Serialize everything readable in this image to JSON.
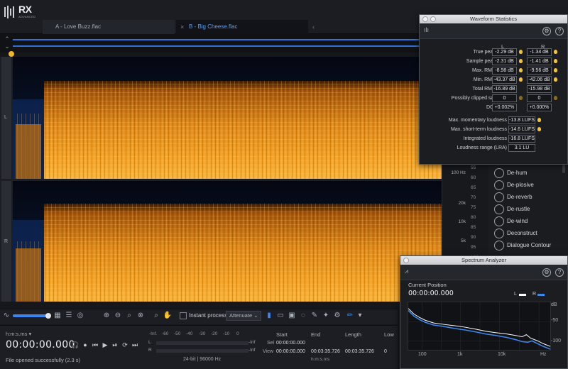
{
  "app": {
    "logo_text": "RX",
    "logo_sub": "ADVANCED"
  },
  "tabs": [
    {
      "label": "A - Love Buzz.flac",
      "active": false
    },
    {
      "label": "B - Big Cheese.flac",
      "active": true
    }
  ],
  "channels": [
    "L",
    "R"
  ],
  "freq_ticks": [
    {
      "label": "100",
      "unit": "Hz"
    },
    {
      "label": "20k",
      "unit": ""
    },
    {
      "label": "10k",
      "unit": ""
    },
    {
      "label": "5k",
      "unit": ""
    },
    {
      "label": "100",
      "unit": ""
    }
  ],
  "db_ticks": [
    "55",
    "60",
    "65",
    "70",
    "75",
    "80",
    "85",
    "90",
    "95",
    "100"
  ],
  "modules": [
    {
      "label": "De-hum",
      "icon": "de-hum-icon"
    },
    {
      "label": "De-plosive",
      "icon": "de-plosive-icon"
    },
    {
      "label": "De-reverb",
      "icon": "de-reverb-icon"
    },
    {
      "label": "De-rustle",
      "icon": "de-rustle-icon"
    },
    {
      "label": "De-wind",
      "icon": "de-wind-icon"
    },
    {
      "label": "Deconstruct",
      "icon": "deconstruct-icon"
    },
    {
      "label": "Dialogue Contour",
      "icon": "dialogue-contour-icon"
    }
  ],
  "toolbar": {
    "instant_process_label": "Instant process",
    "mode_value": "Attenuate"
  },
  "transport": {
    "time_format": "h:m:s.ms",
    "timecode": "00:00:00.000",
    "status": "File opened successfully (2.3 s)",
    "format_info": "24-bit | 96000 Hz"
  },
  "meter": {
    "scale": [
      "-Inf.",
      "-60",
      "-50",
      "-40",
      "-30",
      "-20",
      "-10",
      "0"
    ],
    "left_label": "L",
    "right_label": "R",
    "inf_label": "-Inf"
  },
  "selection": {
    "headers": {
      "start": "Start",
      "end": "End",
      "length": "Length",
      "low": "Low"
    },
    "rows": [
      {
        "label": "Sel",
        "start": "00:00:00.000",
        "end": "",
        "length": "",
        "low": ""
      },
      {
        "label": "View",
        "start": "00:00:00.000",
        "end": "00:03:35.726",
        "length": "00:03:35.726",
        "low": "0"
      }
    ],
    "unit": "h:m:s.ms"
  },
  "waveform_stats": {
    "title": "Waveform Statistics",
    "col_left": "L",
    "col_right": "R",
    "rows": [
      {
        "label": "True peak level",
        "left": "-2.29 dB",
        "right": "-1.34 dB"
      },
      {
        "label": "Sample peak level",
        "left": "-2.31 dB",
        "right": "-1.41 dB"
      },
      {
        "label": "Max. RMS level",
        "left": "-8.98 dB",
        "right": "-9.56 dB"
      },
      {
        "label": "Min. RMS level",
        "left": "-43.37 dB",
        "right": "-42.06 dB"
      },
      {
        "label": "Total RMS level",
        "left": "-16.89 dB",
        "right": "-15.98 dB"
      },
      {
        "label": "Possibly clipped samples",
        "left": "0",
        "right": "0"
      },
      {
        "label": "DC offset",
        "left": "+0.002%",
        "right": "+0.000%"
      }
    ],
    "loudness": [
      {
        "label": "Max. momentary loudness",
        "value": "-13.8 LUFS"
      },
      {
        "label": "Max. short-term loudness",
        "value": "-14.6 LUFS"
      },
      {
        "label": "Integrated loudness",
        "value": "-16.8 LUFS"
      },
      {
        "label": "Loudness range (LRA)",
        "value": "3.1 LU"
      }
    ]
  },
  "spectrum_analyzer": {
    "title": "Spectrum Analyzer",
    "current_position_label": "Current Position",
    "timecode": "00:00:00.000",
    "legend": [
      {
        "label": "L",
        "color": "#ffffff"
      },
      {
        "label": "R",
        "color": "#3c87ef"
      }
    ],
    "x_ticks": [
      "100",
      "1k",
      "10k",
      "Hz"
    ],
    "y_ticks": [
      "dB",
      "-50",
      "-100"
    ]
  },
  "colors": {
    "accent": "#3c87ef",
    "spectrogram_hot": "#f4a21e",
    "bulb": "#f0c33a"
  }
}
